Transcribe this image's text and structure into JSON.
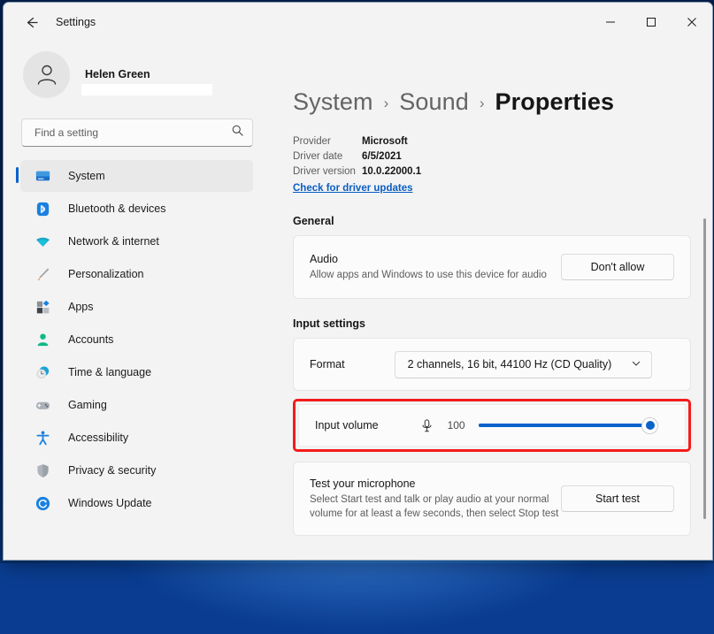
{
  "window": {
    "title": "Settings",
    "back_icon": "back-arrow-icon",
    "controls": {
      "minimize": "minimize-icon",
      "maximize": "maximize-icon",
      "close": "close-icon"
    }
  },
  "account": {
    "name": "Helen Green",
    "email": "",
    "avatar_icon": "person-avatar-icon"
  },
  "search": {
    "placeholder": "Find a setting",
    "value": "",
    "icon": "search-icon"
  },
  "sidebar": {
    "items": [
      {
        "label": "System",
        "icon": "monitor-icon",
        "selected": true
      },
      {
        "label": "Bluetooth & devices",
        "icon": "bluetooth-icon",
        "selected": false
      },
      {
        "label": "Network & internet",
        "icon": "wifi-icon",
        "selected": false
      },
      {
        "label": "Personalization",
        "icon": "paintbrush-icon",
        "selected": false
      },
      {
        "label": "Apps",
        "icon": "apps-grid-icon",
        "selected": false
      },
      {
        "label": "Accounts",
        "icon": "person-icon",
        "selected": false
      },
      {
        "label": "Time & language",
        "icon": "clock-icon",
        "selected": false
      },
      {
        "label": "Gaming",
        "icon": "gamepad-icon",
        "selected": false
      },
      {
        "label": "Accessibility",
        "icon": "accessibility-icon",
        "selected": false
      },
      {
        "label": "Privacy & security",
        "icon": "shield-icon",
        "selected": false
      },
      {
        "label": "Windows Update",
        "icon": "update-refresh-icon",
        "selected": false
      }
    ]
  },
  "breadcrumb": {
    "items": [
      {
        "label": "System",
        "current": false
      },
      {
        "label": "Sound",
        "current": false
      },
      {
        "label": "Properties",
        "current": true
      }
    ],
    "separator": "›"
  },
  "driver_info": {
    "rows": [
      {
        "label": "Provider",
        "value": "Microsoft"
      },
      {
        "label": "Driver date",
        "value": "6/5/2021"
      },
      {
        "label": "Driver version",
        "value": "10.0.22000.1"
      }
    ],
    "link": "Check for driver updates"
  },
  "general": {
    "section_title": "General",
    "audio": {
      "title": "Audio",
      "subtitle": "Allow apps and Windows to use this device for audio",
      "button": "Don't allow"
    }
  },
  "input_settings": {
    "section_title": "Input settings",
    "format": {
      "label": "Format",
      "selected": "2 channels, 16 bit, 44100 Hz (CD Quality)",
      "chevron_icon": "chevron-down-icon"
    },
    "input_volume": {
      "label": "Input volume",
      "mic_icon": "microphone-icon",
      "value": "100",
      "min": 0,
      "max": 100,
      "highlighted": true
    },
    "mic_test": {
      "title": "Test your microphone",
      "subtitle": "Select Start test and talk or play audio at your normal volume for at least a few seconds, then select Stop test",
      "button": "Start test"
    }
  },
  "colors": {
    "accent": "#0a63c9",
    "highlight_box": "#f41b1b",
    "link": "#0a5dc2",
    "window_bg": "#f3f3f3",
    "card_bg": "#fbfbfb"
  }
}
